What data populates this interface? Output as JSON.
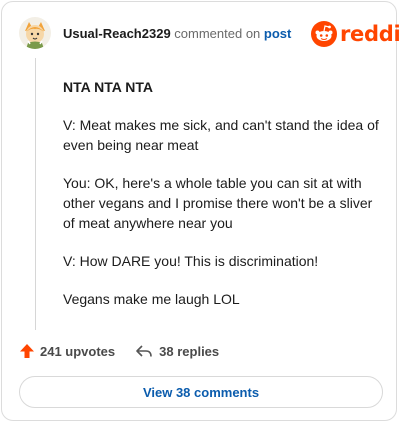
{
  "header": {
    "username": "Usual-Reach2329",
    "action": "commented on",
    "target": "post",
    "brand": "reddit"
  },
  "comment": {
    "paragraphs": [
      "NTA NTA NTA",
      "V: Meat makes me sick, and can't stand the idea of even being near meat",
      "You: OK, here's a whole table you can sit at with other vegans and I promise there won't be a sliver of meat anywhere near you",
      "V: How DARE you! This is discrimination!",
      "Vegans make me laugh LOL"
    ]
  },
  "footer": {
    "upvotes": "241 upvotes",
    "replies": "38 replies",
    "view_comments": "View 38 comments"
  },
  "colors": {
    "brand": "#ff4500",
    "link": "#0b5cad"
  },
  "icons": [
    "avatar",
    "reddit-logo-icon",
    "upvote-arrow-icon",
    "reply-icon"
  ]
}
